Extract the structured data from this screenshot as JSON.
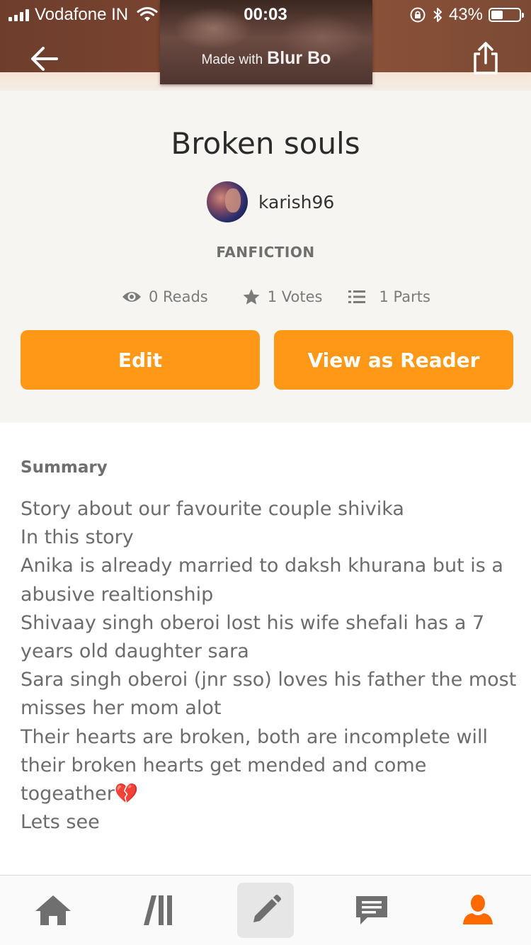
{
  "status_bar": {
    "carrier": "Vodafone IN",
    "time": "00:03",
    "battery": "43%"
  },
  "header": {
    "watermark_small": "Made with",
    "watermark_big": "Blur Bo"
  },
  "story": {
    "title": "Broken souls",
    "author": "karish96",
    "category": "FANFICTION",
    "stats": {
      "reads": "0 Reads",
      "votes": "1 Votes",
      "parts": "1 Parts"
    },
    "buttons": {
      "edit": "Edit",
      "view_as_reader": "View as Reader"
    }
  },
  "summary": {
    "heading": "Summary",
    "lines": [
      "Story about our favourite couple shivika",
      "In this story",
      "Anika is already married to daksh khurana but is a",
      "abusive realtionship",
      "Shivaay singh oberoi lost his wife shefali has a 7",
      "years old daughter sara",
      "Sara singh oberoi (jnr sso) loves his father the most",
      "misses her mom alot",
      "Their hearts are broken, both are incomplete will",
      "their broken hearts get mended and come",
      "togeather💔",
      "Lets see"
    ]
  },
  "bottom_nav": {
    "items": [
      "home-icon",
      "library-icon",
      "write-icon",
      "messages-icon",
      "profile-icon"
    ],
    "active": "profile-icon",
    "accent_color": "#ff6a00"
  },
  "colors": {
    "accent": "#ff9817",
    "header": "#7c4632",
    "info_bg": "#f6f5f1"
  }
}
